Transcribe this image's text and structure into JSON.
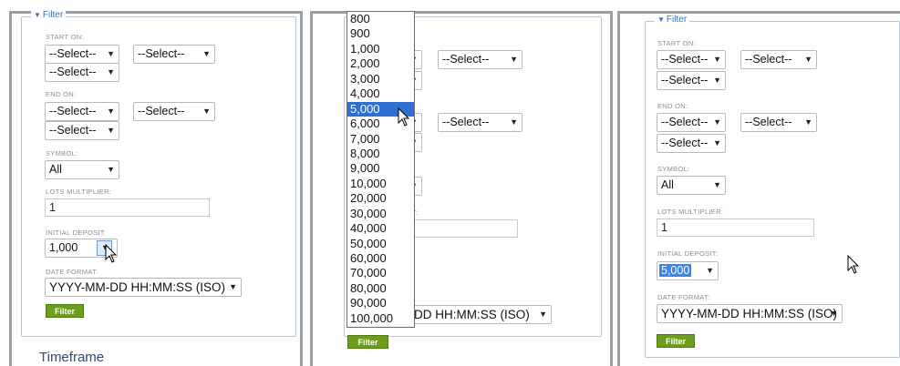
{
  "colors": {
    "accent": "#3b6fb6",
    "button": "#6d9e1b",
    "highlight": "#2e6fcf"
  },
  "panel1": {
    "legend": "Filter",
    "start_on_label": "START ON:",
    "start_selects": [
      "--Select--",
      "--Select--",
      "--Select--"
    ],
    "end_on_label": "END ON:",
    "end_selects": [
      "--Select--",
      "--Select--",
      "--Select--"
    ],
    "symbol_label": "SYMBOL:",
    "symbol_value": "All",
    "lots_label": "LOTS MULTIPLIER:",
    "lots_value": "1",
    "deposit_label": "INITIAL DEPOSIT:",
    "deposit_value": "1,000",
    "date_label": "DATE FORMAT:",
    "date_value": "YYYY-MM-DD HH:MM:SS (ISO)",
    "filter_button": "Filter",
    "timeframe_heading": "Timeframe"
  },
  "panel2": {
    "options": [
      "800",
      "900",
      "1,000",
      "2,000",
      "3,000",
      "4,000",
      "5,000",
      "6,000",
      "7,000",
      "8,000",
      "9,000",
      "10,000",
      "20,000",
      "30,000",
      "40,000",
      "50,000",
      "60,000",
      "70,000",
      "80,000",
      "90,000",
      "100,000"
    ],
    "selected_option": "5,000",
    "select_a": "--Select--",
    "select_b": "--Select--",
    "date_value": "DD HH:MM:SS (ISO)",
    "deposit_field_label_fragment": "T:",
    "filter_button": "Filter"
  },
  "panel3": {
    "legend": "Filter",
    "start_on_label": "START ON:",
    "start_selects": [
      "--Select--",
      "--Select--",
      "--Select--"
    ],
    "end_on_label": "END ON:",
    "end_selects": [
      "--Select--",
      "--Select--",
      "--Select--"
    ],
    "symbol_label": "SYMBOL:",
    "symbol_value": "All",
    "lots_label": "LOTS MULTIPLIER:",
    "lots_value": "1",
    "deposit_label": "INITIAL DEPOSIT:",
    "deposit_value": "5,000",
    "date_label": "DATE FORMAT:",
    "date_value": "YYYY-MM-DD HH:MM:SS (ISO)",
    "filter_button": "Filter"
  }
}
